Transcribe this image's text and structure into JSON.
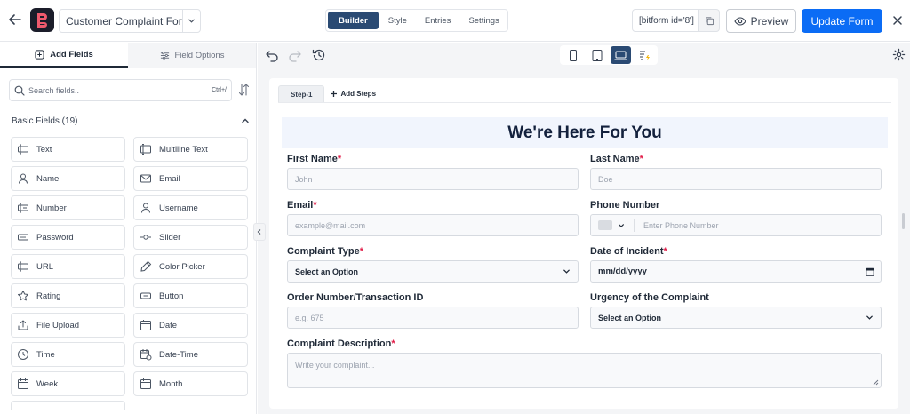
{
  "topbar": {
    "form_title": "Customer Complaint For...",
    "tabs": [
      {
        "label": "Builder",
        "active": true
      },
      {
        "label": "Style",
        "active": false
      },
      {
        "label": "Entries",
        "active": false
      },
      {
        "label": "Settings",
        "active": false
      }
    ],
    "shortcode": "[bitform id='8']",
    "preview_label": "Preview",
    "update_label": "Update Form"
  },
  "left_panel": {
    "tabs": [
      {
        "label": "Add Fields",
        "active": true,
        "icon": "plus-square-icon"
      },
      {
        "label": "Field Options",
        "active": false,
        "icon": "sliders-icon"
      }
    ],
    "search": {
      "placeholder": "Search fields..",
      "shortcut": "Ctrl+/"
    },
    "section_title": "Basic Fields (19)",
    "fields": [
      {
        "label": "Text",
        "icon": "text-icon"
      },
      {
        "label": "Multiline Text",
        "icon": "multiline-text-icon"
      },
      {
        "label": "Name",
        "icon": "user-icon"
      },
      {
        "label": "Email",
        "icon": "mail-icon"
      },
      {
        "label": "Number",
        "icon": "number-icon"
      },
      {
        "label": "Username",
        "icon": "user-icon"
      },
      {
        "label": "Password",
        "icon": "password-icon"
      },
      {
        "label": "Slider",
        "icon": "slider-icon"
      },
      {
        "label": "URL",
        "icon": "url-icon"
      },
      {
        "label": "Color Picker",
        "icon": "eyedropper-icon"
      },
      {
        "label": "Rating",
        "icon": "star-icon"
      },
      {
        "label": "Button",
        "icon": "button-icon"
      },
      {
        "label": "File Upload",
        "icon": "upload-icon"
      },
      {
        "label": "Date",
        "icon": "calendar-icon"
      },
      {
        "label": "Time",
        "icon": "clock-icon"
      },
      {
        "label": "Date-Time",
        "icon": "calendar-clock-icon"
      },
      {
        "label": "Week",
        "icon": "calendar-icon"
      },
      {
        "label": "Month",
        "icon": "calendar-icon"
      }
    ]
  },
  "canvas": {
    "steps": [
      {
        "label": "Step-1"
      }
    ],
    "add_steps_label": "Add Steps",
    "form": {
      "heading": "We're Here For You",
      "first_name": {
        "label": "First Name",
        "placeholder": "John"
      },
      "last_name": {
        "label": "Last Name",
        "placeholder": "Doe"
      },
      "email": {
        "label": "Email",
        "placeholder": "example@mail.com"
      },
      "phone": {
        "label": "Phone Number",
        "placeholder": "Enter Phone Number"
      },
      "complaint_type": {
        "label": "Complaint Type",
        "value": "Select an Option"
      },
      "incident_date": {
        "label": "Date of Incident",
        "value": "mm/dd/yyyy"
      },
      "order_number": {
        "label": "Order Number/Transaction ID",
        "placeholder": "e.g. 675"
      },
      "urgency": {
        "label": "Urgency of the Complaint",
        "value": "Select an Option"
      },
      "description": {
        "label": "Complaint Description",
        "placeholder": "Write your complaint..."
      },
      "required_mark": "*"
    }
  },
  "colors": {
    "accent": "#0b6cf5",
    "active_tab": "#2a4a73",
    "required": "#e11d48",
    "heading_bg": "#f1f5fd"
  }
}
